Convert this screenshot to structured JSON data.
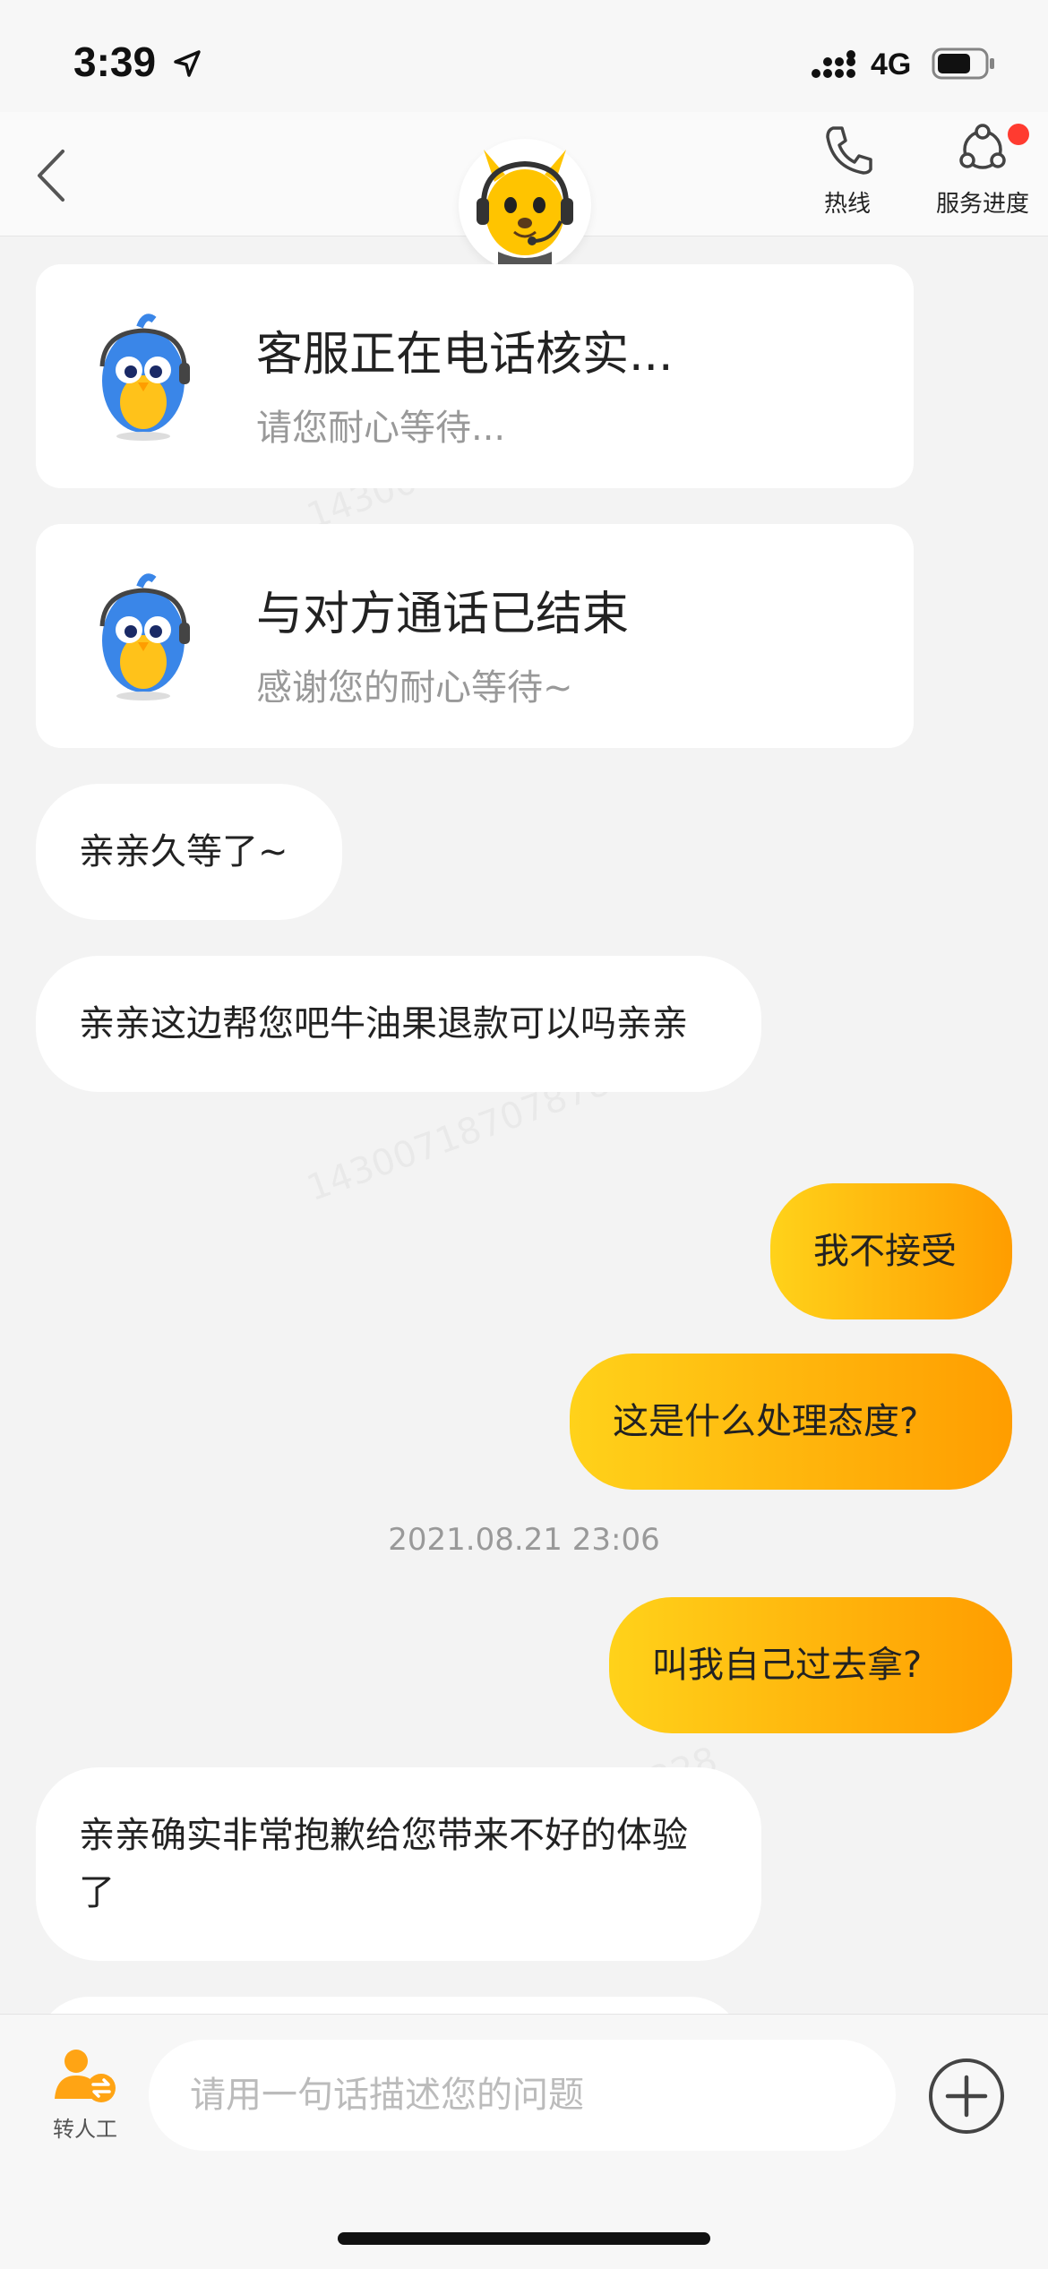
{
  "status_bar": {
    "time": "3:39",
    "network": "4G"
  },
  "nav": {
    "hotline_label": "热线",
    "progress_label": "服务进度",
    "back_icon": "chevron-left-icon",
    "hotline_icon": "phone-icon",
    "progress_icon": "service-progress-icon",
    "notification_color": "#ff3b30"
  },
  "messages": {
    "card1": {
      "title": "客服正在电话核实...",
      "subtitle": "请您耐心等待..."
    },
    "card2": {
      "title": "与对方通话已结束",
      "subtitle": "感谢您的耐心等待~"
    },
    "in1": "亲亲久等了~",
    "in2": "亲亲这边帮您吧牛油果退款可以吗亲亲",
    "out1": "我不接受",
    "out2": "这是什么处理态度?",
    "timestamp": "2021.08.21 23:06",
    "out3": "叫我自己过去拿?",
    "in3": "亲亲确实非常抱歉给您带来不好的体验了"
  },
  "input_bar": {
    "transfer_label": "转人工",
    "placeholder": "请用一句话描述您的问题",
    "transfer_icon": "transfer-agent-icon",
    "plus_icon": "plus-circle-icon"
  },
  "colors": {
    "accent": "#ffb40c",
    "accent_start": "#ffd21a",
    "accent_end": "#ff9d00",
    "background": "#f3f3f3"
  }
}
